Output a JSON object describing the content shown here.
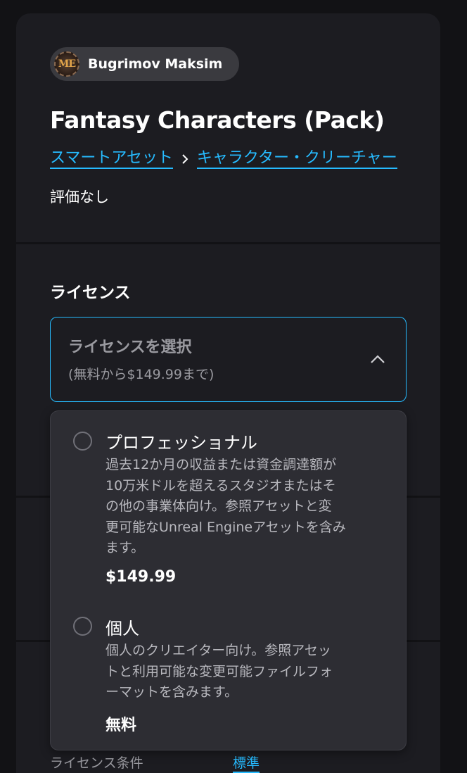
{
  "seller": {
    "name": "Bugrimov Maksim",
    "avatar_monogram": "ME",
    "icon": "seller-avatar-icon"
  },
  "product": {
    "title": "Fantasy Characters (Pack)"
  },
  "breadcrumb": {
    "items": [
      "スマートアセット",
      "キャラクター・クリーチャー"
    ],
    "separator_icon": "chevron-right-icon"
  },
  "rating": {
    "text": "評価なし"
  },
  "license": {
    "heading": "ライセンス",
    "select_title": "ライセンスを選択",
    "select_subtitle": "(無料から$149.99まで)",
    "expand_icon": "chevron-up-icon",
    "options": [
      {
        "name": "プロフェッショナル",
        "description_lines": [
          "過去12か月の収益または資金調達額が",
          "10万米ドルを超えるスタジオまたはそ",
          "の他の事業体向け。参照アセットと変",
          "更可能なUnreal Engineアセットを含み",
          "ます。"
        ],
        "price": "$149.99"
      },
      {
        "name": "個人",
        "description_lines": [
          "個人のクリエイター向け。参照アセッ",
          "トと利用可能な変更可能ファイルフォ",
          "ーマットを含みます。"
        ],
        "price": "無料"
      }
    ]
  },
  "terms": {
    "label": "ライセンス条件",
    "value": "標準"
  },
  "colors": {
    "accent": "#26bbff",
    "card_bg": "#1c1c21",
    "page_bg": "#121215",
    "dropdown_bg": "#2d2d33"
  }
}
